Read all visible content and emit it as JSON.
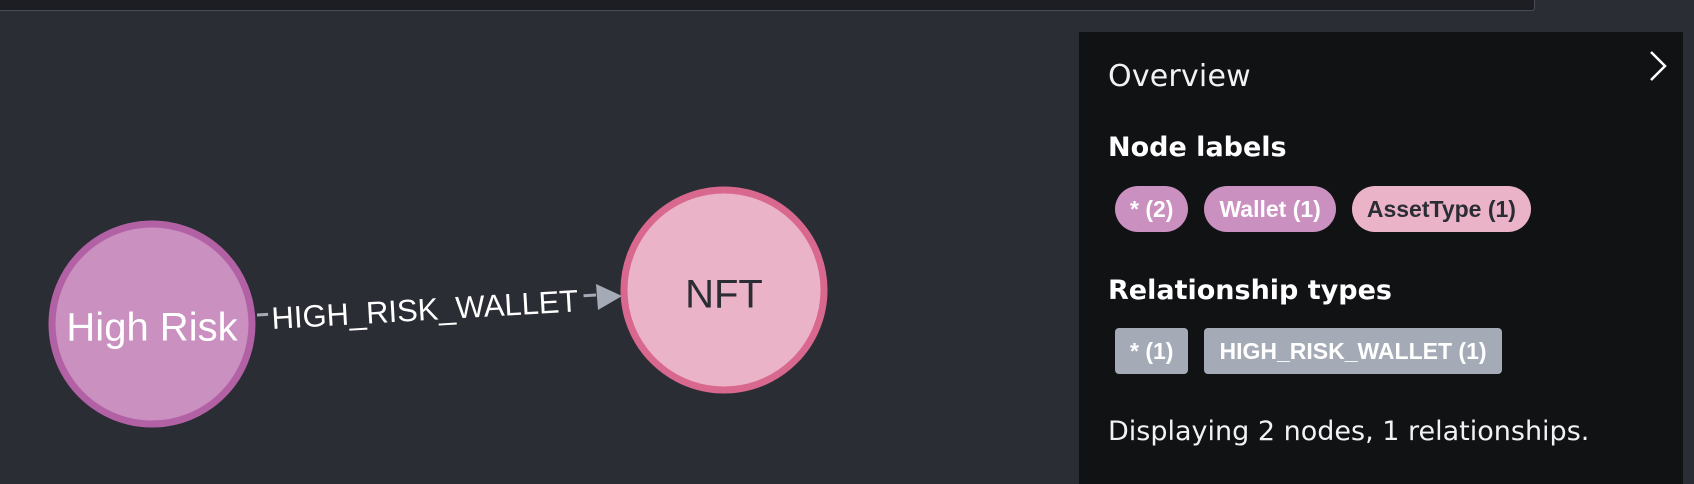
{
  "graph": {
    "nodes": [
      {
        "id": "n1",
        "caption": "High Risk",
        "fill": "#c990c0",
        "stroke": "#b261a5",
        "text_color": "#ffffff"
      },
      {
        "id": "n2",
        "caption": "NFT",
        "fill": "#ebb3c7",
        "stroke": "#d9688f",
        "text_color": "#2b2d35"
      }
    ],
    "relationship": {
      "type": "HIGH_RISK_WALLET",
      "color": "#a5abb6",
      "text_color": "#ffffff"
    }
  },
  "overview": {
    "title": "Overview",
    "collapse_icon": "chevron-right-icon",
    "node_labels_heading": "Node labels",
    "node_labels": [
      {
        "text": "* (2)",
        "bg": "#c990c0",
        "color": "#ffffff"
      },
      {
        "text": "Wallet (1)",
        "bg": "#c990c0",
        "color": "#ffffff"
      },
      {
        "text": "AssetType (1)",
        "bg": "#ebb3c7",
        "color": "#2b2d35"
      }
    ],
    "relationship_types_heading": "Relationship types",
    "relationship_types": [
      {
        "text": "* (1)"
      },
      {
        "text": "HIGH_RISK_WALLET (1)"
      }
    ],
    "status": "Displaying 2 nodes, 1 relationships."
  }
}
